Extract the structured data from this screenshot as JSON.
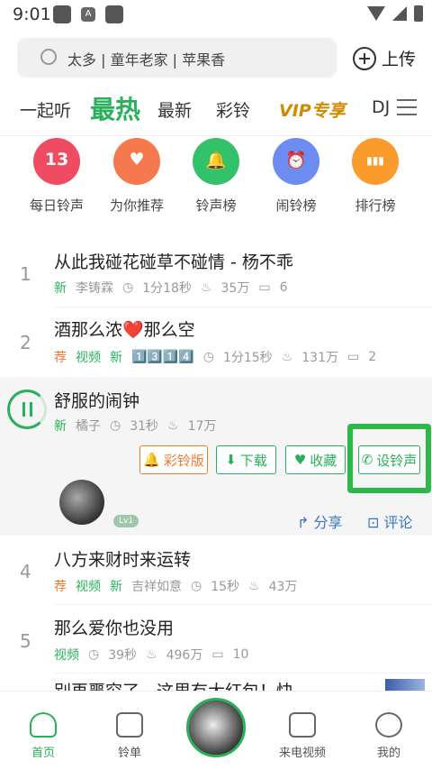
{
  "status": {
    "time": "9:01"
  },
  "search": {
    "placeholder": "太多 | 童年老家 | 苹果香",
    "upload_label": "上传"
  },
  "tabs": [
    {
      "label": "一起听"
    },
    {
      "label": "最热"
    },
    {
      "label": "最新"
    },
    {
      "label": "彩铃"
    },
    {
      "label": "VIP专享"
    },
    {
      "label": "DJ"
    }
  ],
  "categories": [
    {
      "label": "每日铃声",
      "icon": "calendar-icon",
      "glyph": "13",
      "color": "#ef4b63"
    },
    {
      "label": "为你推荐",
      "icon": "heart-box-icon",
      "glyph": "♥",
      "color": "#f5784e"
    },
    {
      "label": "铃声榜",
      "icon": "bell-icon",
      "glyph": "🔔",
      "color": "#33c26a"
    },
    {
      "label": "闹铃榜",
      "icon": "alarm-clock-icon",
      "glyph": "⏰",
      "color": "#6d8cf2"
    },
    {
      "label": "排行榜",
      "icon": "bar-chart-icon",
      "glyph": "▮▮▮",
      "color": "#fb9b2c"
    }
  ],
  "songs": [
    {
      "num": "1",
      "title": "从此我碰花碰草不碰情 - 杨不乖",
      "tags": [
        "新"
      ],
      "artist": "李铸霖",
      "duration": "1分18秒",
      "plays": "35万",
      "comments": "6"
    },
    {
      "num": "2",
      "title": "酒那么浓❤️那么空",
      "tags": [
        "荐",
        "视频",
        "新"
      ],
      "artist": "1️⃣3️⃣1️⃣4️⃣",
      "duration": "1分15秒",
      "plays": "131万",
      "comments": "2"
    },
    {
      "num": "",
      "title": "舒服的闹钟",
      "tags": [
        "新"
      ],
      "artist": "橘子",
      "duration": "31秒",
      "plays": "17万",
      "comments": ""
    },
    {
      "num": "4",
      "title": "八方来财时来运转",
      "tags": [
        "荐",
        "视频",
        "新"
      ],
      "artist": "吉祥如意",
      "duration": "15秒",
      "plays": "43万",
      "comments": ""
    },
    {
      "num": "5",
      "title": "那么爱你也没用",
      "tags": [
        "视频"
      ],
      "artist": "",
      "duration": "39秒",
      "plays": "496万",
      "comments": "10"
    },
    {
      "num": "",
      "title": "别再噩穷了，这里有大红包！快",
      "tags": [],
      "artist": "",
      "duration": "",
      "plays": "",
      "comments": ""
    }
  ],
  "actions": {
    "crbt": "彩铃版",
    "download": "下载",
    "favorite": "收藏",
    "set_ringtone": "设铃声",
    "share": "分享",
    "comment": "评论",
    "level": "Lv1"
  },
  "bottom_nav": [
    {
      "label": "首页"
    },
    {
      "label": "铃单"
    },
    {
      "label": ""
    },
    {
      "label": "来电视频"
    },
    {
      "label": "我的"
    }
  ],
  "colors": {
    "accent": "#28b05a",
    "orange": "#f07b2e",
    "link": "#3a75c4"
  }
}
